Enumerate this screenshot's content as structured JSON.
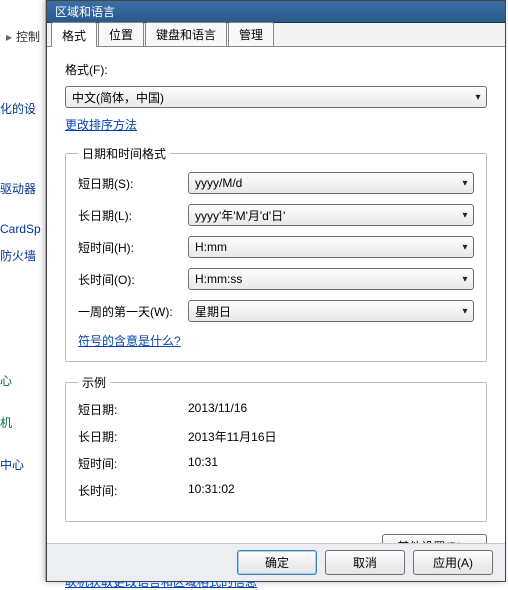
{
  "window_title": "区域和语言",
  "breadcrumb_item": "控制",
  "side_heading": "化的设",
  "side_items": [
    "驱动器",
    "CardSp",
    "防火墙"
  ],
  "side_footer": [
    "心",
    "机",
    "中心"
  ],
  "tabs": [
    "格式",
    "位置",
    "键盘和语言",
    "管理"
  ],
  "format_label": "格式(F):",
  "format_value": "中文(简体，中国)",
  "change_sort_link": "更改排序方法",
  "grp1_title": "日期和时间格式",
  "fields": {
    "short_date_lbl": "短日期(S):",
    "short_date_val": "yyyy/M/d",
    "long_date_lbl": "长日期(L):",
    "long_date_val": "yyyy'年'M'月'd'日'",
    "short_time_lbl": "短时间(H):",
    "short_time_val": "H:mm",
    "long_time_lbl": "长时间(O):",
    "long_time_val": "H:mm:ss",
    "first_day_lbl": "一周的第一天(W):",
    "first_day_val": "星期日"
  },
  "symbol_link": "符号的含意是什么?",
  "grp2_title": "示例",
  "examples": {
    "short_date_lbl": "短日期:",
    "short_date_val": "2013/11/16",
    "long_date_lbl": "长日期:",
    "long_date_val": "2013年11月16日",
    "short_time_lbl": "短时间:",
    "short_time_val": "10:31",
    "long_time_lbl": "长时间:",
    "long_time_val": "10:31:02"
  },
  "additional_btn": "其他设置(D)...",
  "online_link": "联机获取更改语言和区域格式的信息",
  "ok_btn": "确定",
  "cancel_btn": "取消",
  "apply_btn": "应用(A)"
}
